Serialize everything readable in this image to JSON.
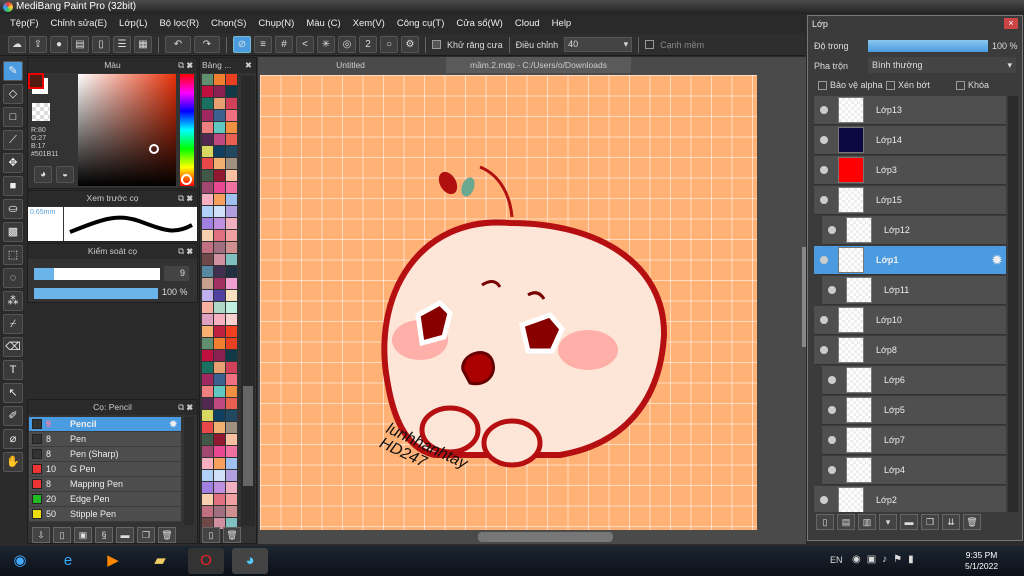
{
  "window": {
    "title": "MediBang Paint Pro (32bit)"
  },
  "menu": [
    "Tệp(F)",
    "Chỉnh sửa(E)",
    "Lớp(L)",
    "Bộ lọc(R)",
    "Chọn(S)",
    "Chụp(N)",
    "Màu (C)",
    "Xem(V)",
    "Công cụ(T)",
    "Cửa sổ(W)",
    "Cloud",
    "Help"
  ],
  "toolbar": {
    "antialias_label": "Khử răng cưa",
    "adjust_label": "Điều chỉnh",
    "adjust_value": "40",
    "soft_edge_label": "Cạnh mềm"
  },
  "color_panel": {
    "title": "Màu",
    "r": "R:80",
    "g": "G:27",
    "b": "B:17",
    "hex": "#501B11",
    "fg_color": "#501B11"
  },
  "preview_panel": {
    "title": "Xem trước cọ",
    "size": "0.65mm"
  },
  "control_panel": {
    "title": "Kiểm soát cọ",
    "size_value": "9",
    "size_fraction": 0.16,
    "opacity_value": "100 %",
    "opacity_fraction": 1.0
  },
  "brush_panel": {
    "title": "Cọ: Pencil",
    "brushes": [
      {
        "size": "9",
        "name": "Pencil",
        "color": "#333333",
        "selected": true
      },
      {
        "size": "8",
        "name": "Pen",
        "color": "#333333"
      },
      {
        "size": "8",
        "name": "Pen (Sharp)",
        "color": "#333333"
      },
      {
        "size": "10",
        "name": "G Pen",
        "color": "#ee3333"
      },
      {
        "size": "8",
        "name": "Mapping Pen",
        "color": "#ee3333"
      },
      {
        "size": "20",
        "name": "Edge Pen",
        "color": "#22bb22"
      },
      {
        "size": "50",
        "name": "Stipple Pen",
        "color": "#eedd11"
      }
    ]
  },
  "palette_panel": {
    "title": "Bảng ...",
    "colors": [
      "#5f8f6f",
      "#f08030",
      "#e84020",
      "#c01040",
      "#8a2050",
      "#103a48",
      "#1a7060",
      "#e8a070",
      "#d04058",
      "#a02860",
      "#3a6090",
      "#f07080",
      "#f08080",
      "#60c8c0",
      "#f09040",
      "#502850",
      "#c04880",
      "#e86050",
      "#d8d860",
      "#104060",
      "#204860",
      "#e84848",
      "#f0b070",
      "#a09080",
      "#405848",
      "#901830",
      "#f8c0a0",
      "#a04870",
      "#e84890",
      "#f070a0",
      "#f8b0c0",
      "#f8a060",
      "#a0c0f0",
      "#b0d0f8",
      "#d0e0f8",
      "#b0a0e0",
      "#a080e0",
      "#c090e0",
      "#f0b0c0",
      "#f8d0b0",
      "#e07080",
      "#f0a0a0",
      "#c07080",
      "#a07080",
      "#d09090",
      "#704848",
      "#d090a0",
      "#80c0c0",
      "#5888a0",
      "#403050",
      "#203040",
      "#c8a090",
      "#a03060",
      "#f0a0d0",
      "#c0b0f0",
      "#5040a0",
      "#f8e0c0",
      "#f8b0a0",
      "#b0d8c8",
      "#c0f0e0",
      "#e0a0c0",
      "#f8b0c0",
      "#f8d0d0",
      "#f8b070",
      "#c02040",
      "#f04020"
    ]
  },
  "document": {
    "tab_untitled": "Untitled",
    "tab_active": "mầm.2.mdp - C:/Users/o/Downloads",
    "signature": "lunhhanhtay HD247"
  },
  "layer_panel": {
    "title": "Lớp",
    "opacity_label": "Độ trong",
    "opacity_value": "100 %",
    "opacity_fraction": 1.0,
    "blend_label": "Pha trộn",
    "blend_value": "Bình thường",
    "protect_alpha": "Bảo vệ alpha",
    "clipping": "Xén bớt",
    "lock": "Khóa",
    "layers": [
      {
        "name": "Lớp13",
        "thumb": "#ffffff"
      },
      {
        "name": "Lớp14",
        "thumb": "#0a0a40"
      },
      {
        "name": "Lớp3",
        "thumb": "#ff0000"
      },
      {
        "name": "Lớp15",
        "thumb": "#ffffff"
      },
      {
        "name": "Lớp12",
        "thumb": "#ffffff",
        "indent": true
      },
      {
        "name": "Lớp1",
        "thumb": "#ffffff",
        "selected": true
      },
      {
        "name": "Lớp11",
        "thumb": "#ffffff",
        "indent": true
      },
      {
        "name": "Lớp10",
        "thumb": "#ffffff"
      },
      {
        "name": "Lớp8",
        "thumb": "#ffffff"
      },
      {
        "name": "Lớp6",
        "thumb": "#ffffff",
        "indent": true
      },
      {
        "name": "Lớp5",
        "thumb": "#ffffff",
        "indent": true
      },
      {
        "name": "Lớp7",
        "thumb": "#ffffff",
        "indent": true
      },
      {
        "name": "Lớp4",
        "thumb": "#ffffff",
        "indent": true
      },
      {
        "name": "Lớp2",
        "thumb": "#ffffff"
      }
    ]
  },
  "taskbar": {
    "lang": "EN",
    "time": "9:35 PM",
    "date": "5/1/2022"
  }
}
